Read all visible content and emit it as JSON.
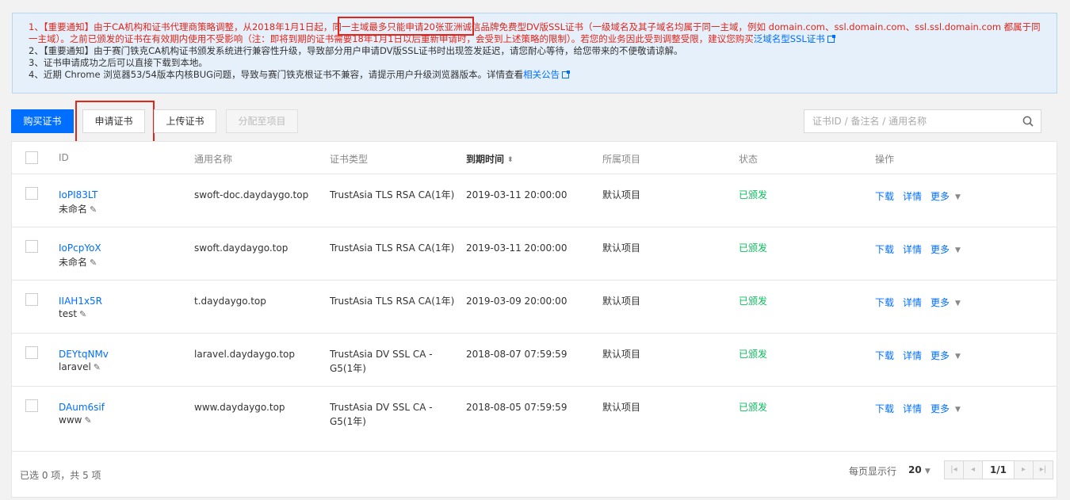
{
  "notice": {
    "line1_pre": "1、【重要通知】由于CA机构和证书代理商策略调整，从2018年1月1日起，同一主域最多只能申请20张亚洲诚信品牌免费型DV版SSL证书（一级域名及其子域名均属于同一主域，例如 domain.com、ssl.domain.com、ssl.ssl.domain.com 都属于同一主域）。之前已颁发的证书在有效期内使用不受影响（注：即将到期的证书需要18年1月1日以后重新申请时，会受到上述策略的限制）。若您的业务因此受到调整受限，建议您购买",
    "line1_link": "泛域名型SSL证书",
    "line2": "2、【重要通知】由于赛门铁克CA机构证书颁发系统进行兼容性升级，导致部分用户申请DV版SSL证书时出现签发延迟，请您耐心等待，给您带来的不便敬请谅解。",
    "line3": "3、证书申请成功之后可以直接下载到本地。",
    "line4_pre": "4、近期 Chrome 浏览器53/54版本内核BUG问题，导致与赛门铁克根证书不兼容，请提示用户升级浏览器版本。详情查看",
    "line4_link": "相关公告"
  },
  "toolbar": {
    "buy_label": "购买证书",
    "apply_label": "申请证书",
    "upload_label": "上传证书",
    "assign_label": "分配至项目",
    "search_placeholder": "证书ID / 备注名 / 通用名称"
  },
  "table": {
    "headers": {
      "id": "ID",
      "common_name": "通用名称",
      "cert_type": "证书类型",
      "expiry": "到期时间",
      "project": "所属项目",
      "status": "状态",
      "actions": "操作"
    },
    "rows": [
      {
        "id": "IoPI83LT",
        "alias": "未命名",
        "common_name": "swoft-doc.daydaygo.top",
        "cert_type_1": "TrustAsia TLS RSA CA(1年)",
        "cert_type_2": "",
        "expiry": "2019-03-11 20:00:00",
        "project": "默认项目",
        "status": "已颁发"
      },
      {
        "id": "IoPcpYoX",
        "alias": "未命名",
        "common_name": "swoft.daydaygo.top",
        "cert_type_1": "TrustAsia TLS RSA CA(1年)",
        "cert_type_2": "",
        "expiry": "2019-03-11 20:00:00",
        "project": "默认项目",
        "status": "已颁发"
      },
      {
        "id": "IIAH1x5R",
        "alias": "test",
        "common_name": "t.daydaygo.top",
        "cert_type_1": "TrustAsia TLS RSA CA(1年)",
        "cert_type_2": "",
        "expiry": "2019-03-09 20:00:00",
        "project": "默认项目",
        "status": "已颁发"
      },
      {
        "id": "DEYtqNMv",
        "alias": "laravel",
        "common_name": "laravel.daydaygo.top",
        "cert_type_1": "TrustAsia DV SSL CA -",
        "cert_type_2": "G5(1年)",
        "expiry": "2018-08-07 07:59:59",
        "project": "默认项目",
        "status": "已颁发"
      },
      {
        "id": "DAum6sif",
        "alias": "www",
        "common_name": "www.daydaygo.top",
        "cert_type_1": "TrustAsia DV SSL CA -",
        "cert_type_2": "G5(1年)",
        "expiry": "2018-08-05 07:59:59",
        "project": "默认项目",
        "status": "已颁发"
      }
    ],
    "row_actions": {
      "download": "下载",
      "details": "详情",
      "more": "更多"
    }
  },
  "footer": {
    "selection_info": "已选 0 项，共 5 项",
    "per_page_label": "每页显示行",
    "per_page_value": "20",
    "page_indicator": "1/1"
  },
  "colors": {
    "primary": "#006eff",
    "status_green": "#0abf5b",
    "notice_red": "#e1251b",
    "notice_bg": "#e5f0fb"
  }
}
